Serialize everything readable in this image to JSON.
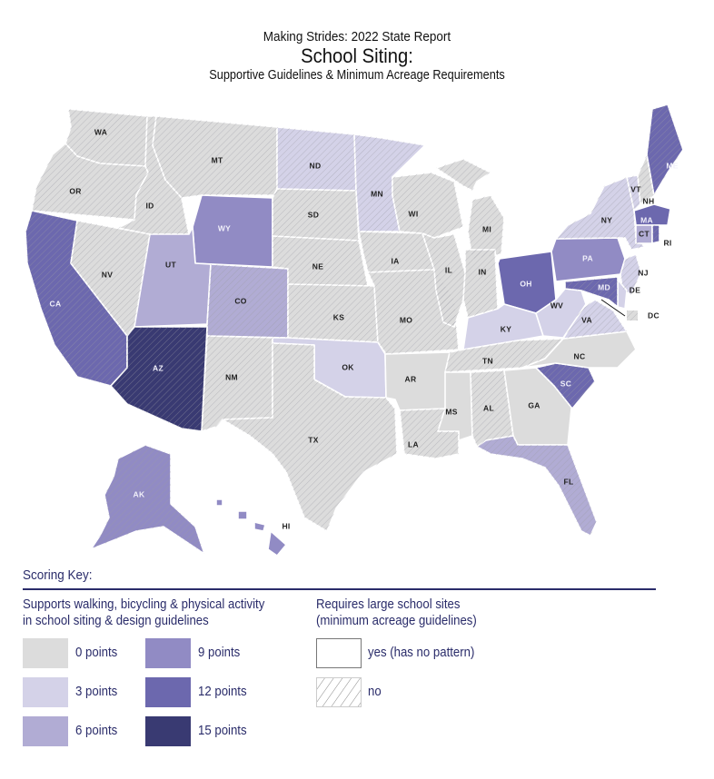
{
  "header": {
    "subtitle": "Making Strides:  2022 State Report",
    "title": "School Siting:",
    "description": "Supportive Guidelines & Minimum Acreage Requirements"
  },
  "colors": {
    "text_navy": "#2a2c6a",
    "score_0": "#dcdcdc",
    "score_3": "#d4d2e8",
    "score_6": "#b1acd4",
    "score_9": "#918bc4",
    "score_12": "#6c68ae",
    "score_15": "#393a72"
  },
  "key": {
    "title": "Scoring Key:",
    "score_heading_line1": "Supports walking, bicycling & physical activity",
    "score_heading_line2": "in school siting & design guidelines",
    "acreage_heading_line1": "Requires large school sites",
    "acreage_heading_line2": "(minimum acreage guidelines)",
    "scores": [
      {
        "points": 0,
        "label": "0 points"
      },
      {
        "points": 3,
        "label": "3 points"
      },
      {
        "points": 6,
        "label": "6 points"
      },
      {
        "points": 9,
        "label": "9 points"
      },
      {
        "points": 12,
        "label": "12 points"
      },
      {
        "points": 15,
        "label": "15 points"
      }
    ],
    "acreage": [
      {
        "pattern": "none",
        "label": "yes (has no pattern)"
      },
      {
        "pattern": "hatch",
        "label": "no"
      }
    ]
  },
  "states": [
    {
      "abbr": "WA",
      "score": 0,
      "hatch": true
    },
    {
      "abbr": "OR",
      "score": 0,
      "hatch": true
    },
    {
      "abbr": "CA",
      "score": 12,
      "hatch": true
    },
    {
      "abbr": "NV",
      "score": 0,
      "hatch": true
    },
    {
      "abbr": "ID",
      "score": 0,
      "hatch": true
    },
    {
      "abbr": "MT",
      "score": 0,
      "hatch": true
    },
    {
      "abbr": "WY",
      "score": 9,
      "hatch": false
    },
    {
      "abbr": "UT",
      "score": 6,
      "hatch": false
    },
    {
      "abbr": "CO",
      "score": 6,
      "hatch": true
    },
    {
      "abbr": "AZ",
      "score": 15,
      "hatch": true
    },
    {
      "abbr": "NM",
      "score": 0,
      "hatch": true
    },
    {
      "abbr": "ND",
      "score": 3,
      "hatch": true
    },
    {
      "abbr": "SD",
      "score": 0,
      "hatch": true
    },
    {
      "abbr": "NE",
      "score": 0,
      "hatch": true
    },
    {
      "abbr": "KS",
      "score": 0,
      "hatch": true
    },
    {
      "abbr": "OK",
      "score": 3,
      "hatch": false
    },
    {
      "abbr": "TX",
      "score": 0,
      "hatch": true
    },
    {
      "abbr": "MN",
      "score": 3,
      "hatch": true
    },
    {
      "abbr": "IA",
      "score": 0,
      "hatch": true
    },
    {
      "abbr": "MO",
      "score": 0,
      "hatch": true
    },
    {
      "abbr": "AR",
      "score": 0,
      "hatch": false
    },
    {
      "abbr": "LA",
      "score": 0,
      "hatch": true
    },
    {
      "abbr": "WI",
      "score": 0,
      "hatch": true
    },
    {
      "abbr": "IL",
      "score": 0,
      "hatch": true
    },
    {
      "abbr": "MI",
      "score": 0,
      "hatch": true
    },
    {
      "abbr": "IN",
      "score": 0,
      "hatch": true
    },
    {
      "abbr": "OH",
      "score": 12,
      "hatch": false
    },
    {
      "abbr": "KY",
      "score": 3,
      "hatch": false
    },
    {
      "abbr": "TN",
      "score": 0,
      "hatch": true
    },
    {
      "abbr": "MS",
      "score": 0,
      "hatch": false
    },
    {
      "abbr": "AL",
      "score": 0,
      "hatch": true
    },
    {
      "abbr": "GA",
      "score": 0,
      "hatch": false
    },
    {
      "abbr": "FL",
      "score": 6,
      "hatch": true
    },
    {
      "abbr": "SC",
      "score": 12,
      "hatch": true
    },
    {
      "abbr": "NC",
      "score": 0,
      "hatch": false
    },
    {
      "abbr": "VA",
      "score": 3,
      "hatch": true
    },
    {
      "abbr": "WV",
      "score": 3,
      "hatch": false
    },
    {
      "abbr": "PA",
      "score": 9,
      "hatch": false
    },
    {
      "abbr": "NY",
      "score": 3,
      "hatch": true
    },
    {
      "abbr": "VT",
      "score": 3,
      "hatch": true
    },
    {
      "abbr": "NH",
      "score": 0,
      "hatch": true
    },
    {
      "abbr": "ME",
      "score": 12,
      "hatch": true
    },
    {
      "abbr": "MA",
      "score": 12,
      "hatch": false
    },
    {
      "abbr": "CT",
      "score": 6,
      "hatch": false
    },
    {
      "abbr": "RI",
      "score": 12,
      "hatch": true
    },
    {
      "abbr": "NJ",
      "score": 3,
      "hatch": true
    },
    {
      "abbr": "DE",
      "score": 3,
      "hatch": false
    },
    {
      "abbr": "MD",
      "score": 12,
      "hatch": true
    },
    {
      "abbr": "DC",
      "score": 0,
      "hatch": true
    },
    {
      "abbr": "AK",
      "score": 9,
      "hatch": true
    },
    {
      "abbr": "HI",
      "score": 9,
      "hatch": false
    }
  ]
}
